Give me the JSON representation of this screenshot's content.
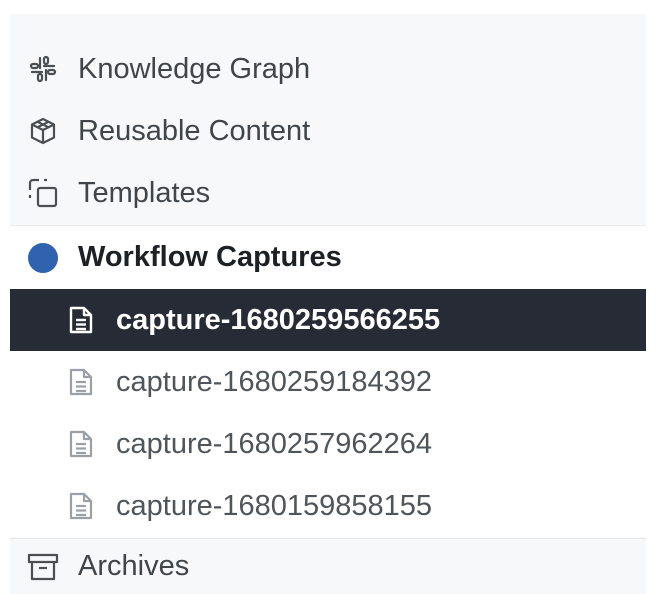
{
  "nav": {
    "items": [
      {
        "label": "Knowledge Graph",
        "icon": "knowledge-graph-icon"
      },
      {
        "label": "Reusable Content",
        "icon": "cube-icon"
      },
      {
        "label": "Templates",
        "icon": "templates-icon"
      }
    ],
    "section": {
      "label": "Workflow Captures",
      "icon": "circle-icon",
      "color": "#2f63b0"
    },
    "captures": [
      {
        "label": "capture-1680259566255",
        "active": true
      },
      {
        "label": "capture-1680259184392",
        "active": false
      },
      {
        "label": "capture-1680257962264",
        "active": false
      },
      {
        "label": "capture-1680159858155",
        "active": false
      }
    ],
    "footer": {
      "label": "Archives",
      "icon": "archive-box-icon"
    }
  },
  "colors": {
    "active_bg": "#262b36",
    "section_dot": "#2f63b0"
  }
}
